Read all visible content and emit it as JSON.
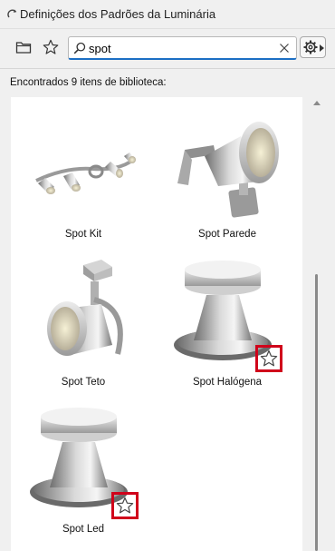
{
  "window": {
    "title": "Definições dos Padrões da Luminária"
  },
  "search": {
    "value": "spot"
  },
  "results": {
    "summary": "Encontrados 9 itens de biblioteca:",
    "items": [
      {
        "label": "Spot Kit",
        "favorite_marked": false
      },
      {
        "label": "Spot Parede",
        "favorite_marked": false
      },
      {
        "label": "Spot Teto",
        "favorite_marked": false
      },
      {
        "label": "Spot Halógena",
        "favorite_marked": true
      },
      {
        "label": "Spot Led",
        "favorite_marked": true
      }
    ]
  },
  "colors": {
    "accent": "#1c6fc4",
    "highlight": "#d0021b"
  }
}
